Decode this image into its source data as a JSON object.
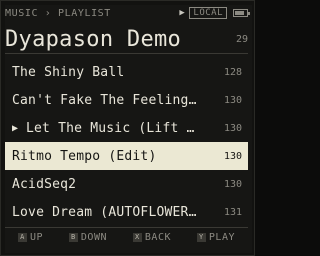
{
  "status": {
    "breadcrumb": "MUSIC › PLAYLIST",
    "source": "LOCAL"
  },
  "header": {
    "title": "Dyapason Demo",
    "count": "29"
  },
  "tracks": [
    {
      "name": "The Shiny Ball",
      "bpm": "128"
    },
    {
      "name": "Can't Fake The Feeling…",
      "bpm": "130"
    },
    {
      "name": "Let The Music (Lift …",
      "bpm": "130",
      "playing": true
    },
    {
      "name": "Ritmo Tempo (Edit)",
      "bpm": "130",
      "selected": true
    },
    {
      "name": "AcidSeq2",
      "bpm": "130"
    },
    {
      "name": "Love Dream (AUTOFLOWER…",
      "bpm": "131"
    }
  ],
  "hints": [
    {
      "key": "A",
      "label": "UP"
    },
    {
      "key": "B",
      "label": "DOWN"
    },
    {
      "key": "X",
      "label": "BACK"
    },
    {
      "key": "Y",
      "label": "PLAY"
    }
  ],
  "colors": {
    "background": "#161614",
    "text": "#e9e6da",
    "muted": "#8c8a82",
    "selection": "#ebe8d3"
  },
  "icons": {
    "playing_indicator": "play-triangle-icon",
    "battery": "battery-icon"
  }
}
